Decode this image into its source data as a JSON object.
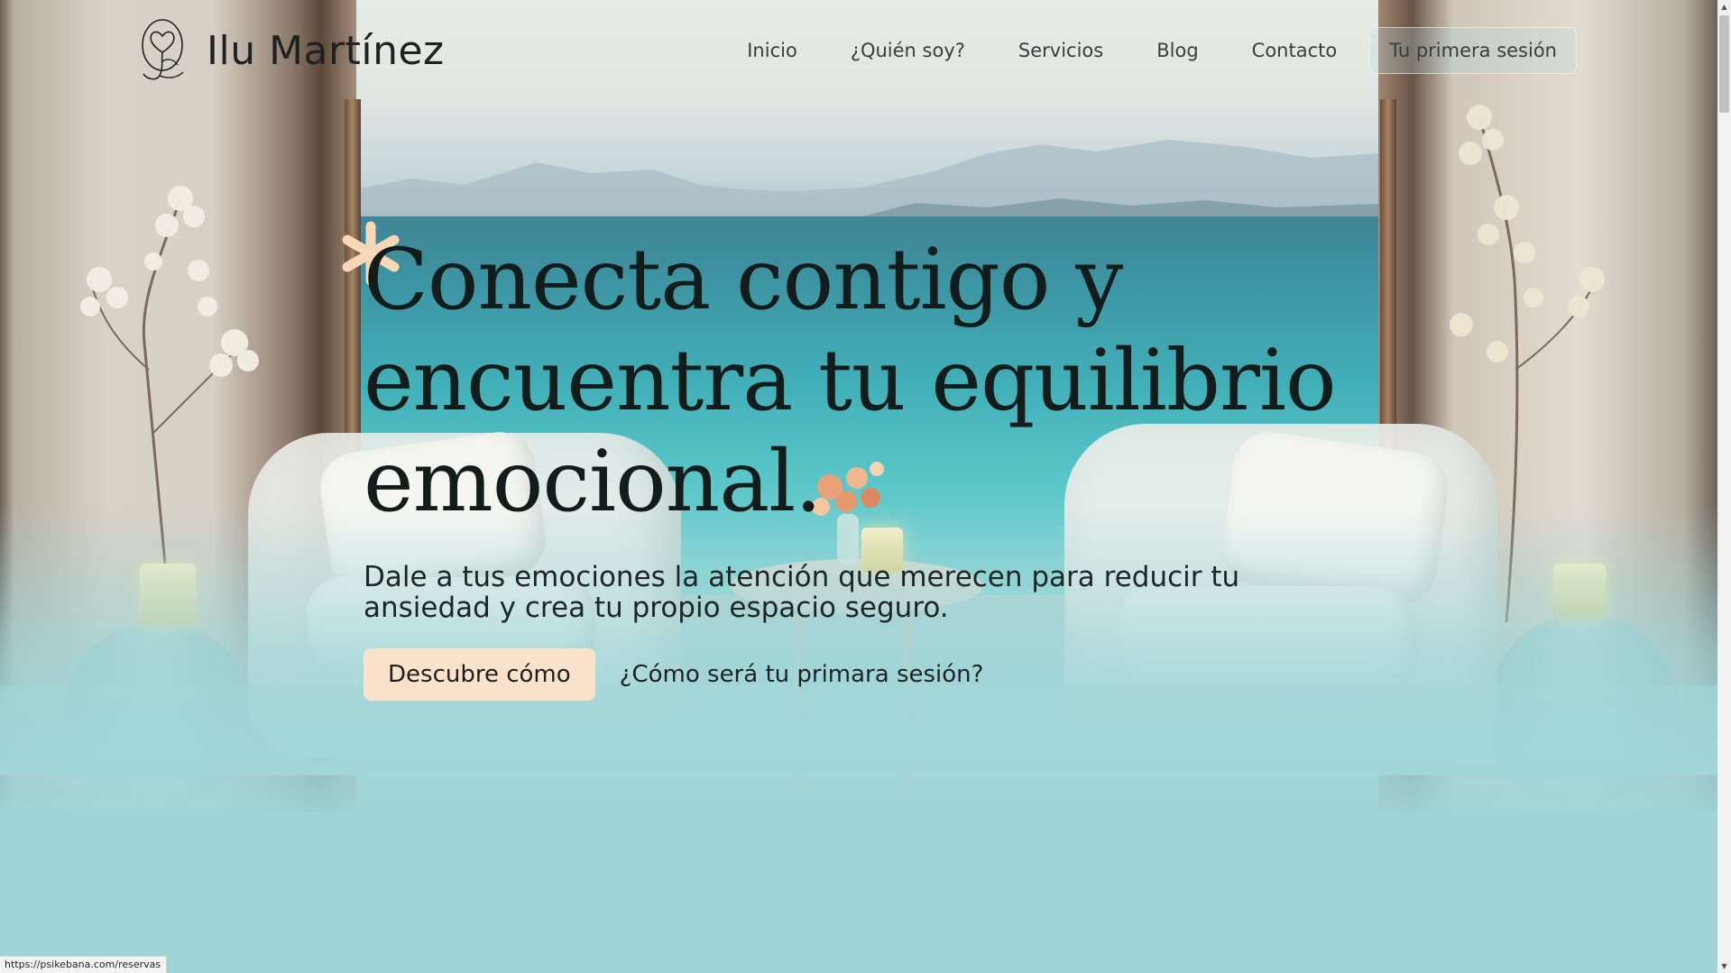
{
  "colors": {
    "accent_button_bg": "#fbe3cb",
    "asterisk": "#f6d7b8",
    "page_bg": "#9fd5d8",
    "title_text": "#121c1b"
  },
  "header": {
    "logo_text": "Ilu Martínez",
    "logo_icon": "heart-flower-logo",
    "nav": [
      "Inicio",
      "¿Quién soy?",
      "Servicios",
      "Blog",
      "Contacto"
    ],
    "cta_label": "Tu primera sesión"
  },
  "hero": {
    "decor_icon": "asterisk-icon",
    "title": "Conecta contigo y\nencuentra tu equilibrio\nemocional.",
    "subtitle": "Dale a tus emociones la atención que merecen para reducir tu ansiedad y crea tu propio espacio seguro.",
    "primary_button": "Descubre cómo",
    "secondary_link": "¿Cómo será tu primara sesión?"
  },
  "status_bar": {
    "url": "https://psikebana.com/reservas"
  }
}
